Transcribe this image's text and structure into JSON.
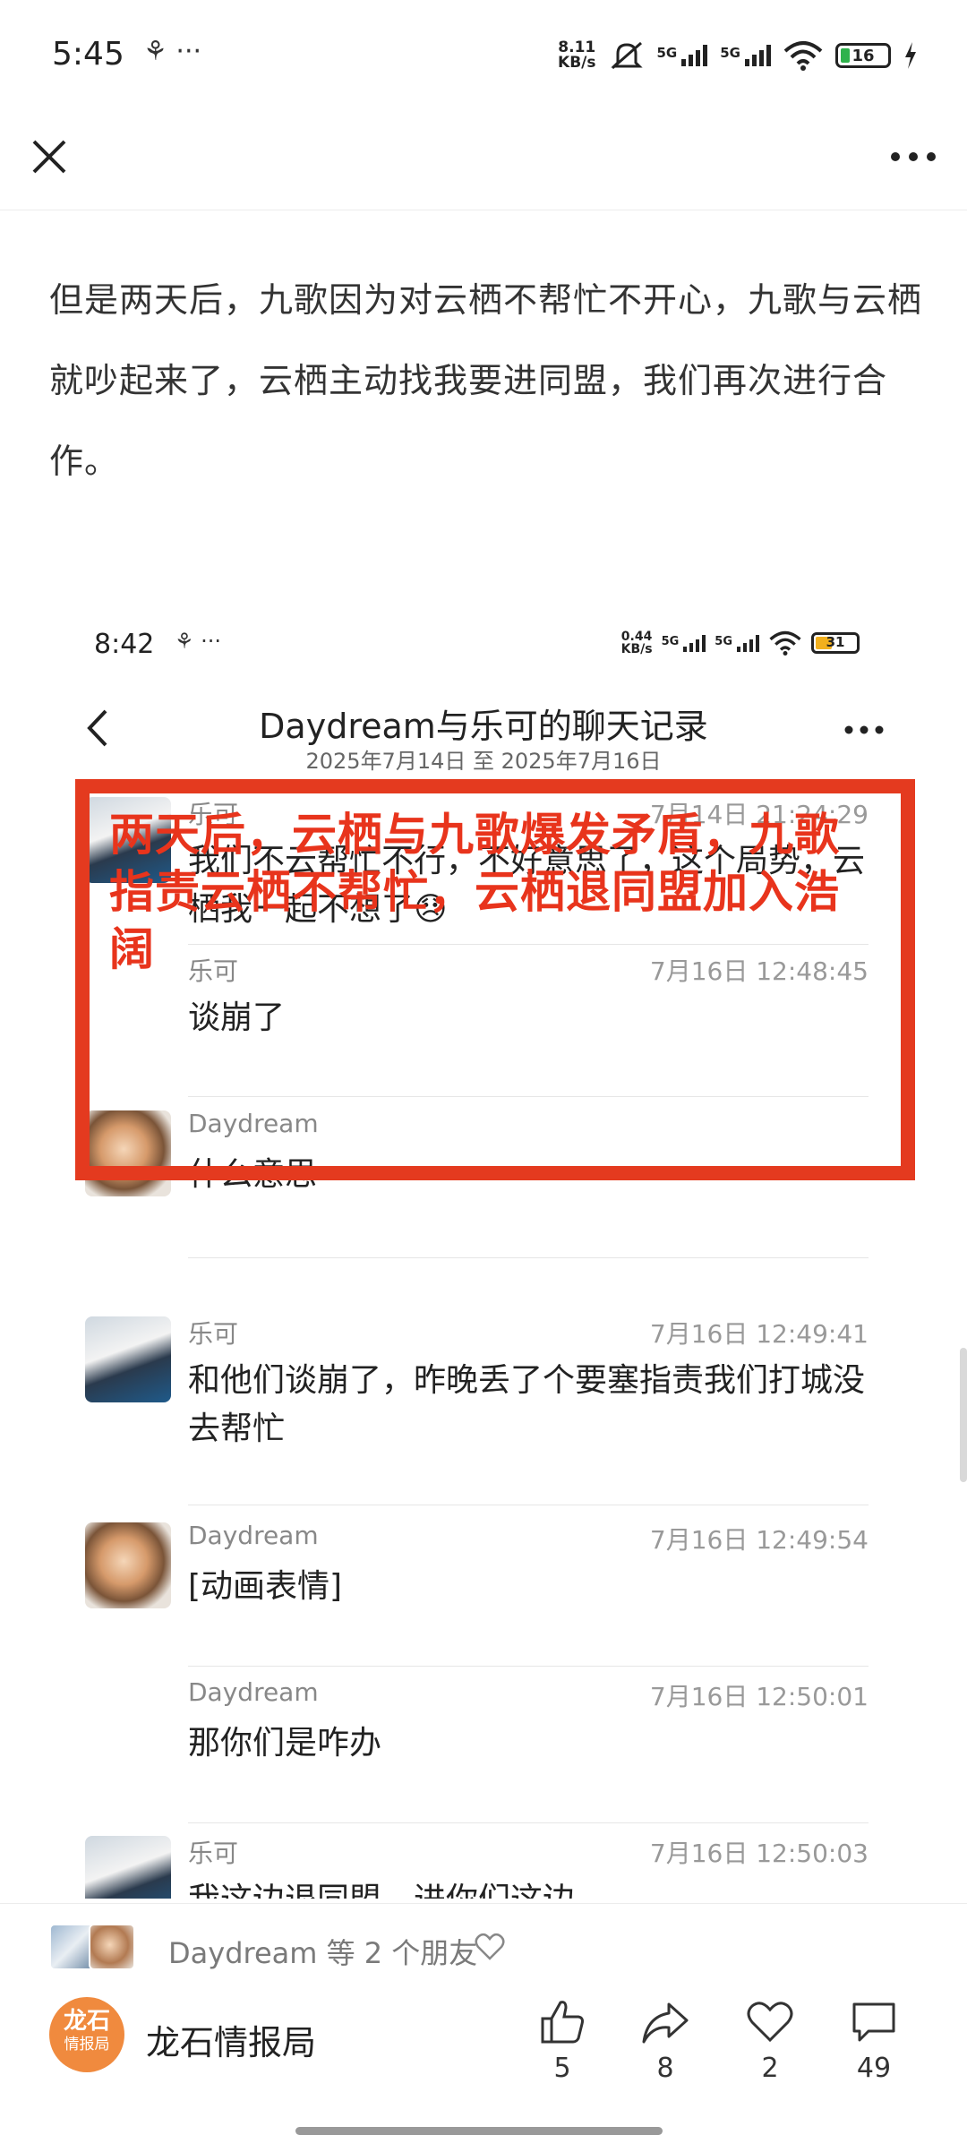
{
  "status_bar": {
    "time": "5:45",
    "left_icons": "⚘ ···",
    "net_speed_value": "8.11",
    "net_speed_unit": "KB/s",
    "signal_1": "5G",
    "signal_2": "5G",
    "battery": "16"
  },
  "article": {
    "paragraph": "但是两天后，九歌因为对云栖不帮忙不开心，九歌与云栖就吵起来了，云栖主动找我要进同盟，我们再次进行合作。"
  },
  "embedded": {
    "status": {
      "time": "8:42",
      "left_icons": "⚘ ···",
      "net_speed_value": "0.44",
      "net_speed_unit": "KB/s",
      "signal_1": "5G",
      "signal_2": "5G",
      "battery": "31"
    },
    "title": "Daydream与乐可的聊天记录",
    "subtitle": "2025年7月14日 至 2025年7月16日",
    "messages": [
      {
        "name": "乐可",
        "time": "7月14日 21:24:29",
        "text": "我们不云帮忙不行，不好意思了，这个局势，云栖我一起不想了😞"
      },
      {
        "name": "乐可",
        "time": "7月16日 12:48:45",
        "text": "谈崩了"
      },
      {
        "name": "Daydream",
        "time": "",
        "text": "什么意思"
      },
      {
        "name": "乐可",
        "time": "7月16日 12:49:41",
        "text": "和他们谈崩了，昨晚丢了个要塞指责我们打城没去帮忙"
      },
      {
        "name": "Daydream",
        "time": "7月16日 12:49:54",
        "text": "[动画表情]"
      },
      {
        "name": "Daydream",
        "time": "7月16日 12:50:01",
        "text": "那你们是咋办"
      },
      {
        "name": "乐可",
        "time": "7月16日 12:50:03",
        "text": "我这边退同盟，进你们这边"
      }
    ],
    "overlay_annotation": "两天后，云栖与九歌爆发矛盾，九歌指责云栖不帮忙，云栖退同盟加入浩阔"
  },
  "friends_bar": {
    "text": "Daydream 等 2 个朋友"
  },
  "bottom_bar": {
    "logo_line1": "龙石",
    "logo_line2": "情报局",
    "author": "龙石情报局",
    "like_count": "5",
    "share_count": "8",
    "favorite_count": "2",
    "comment_count": "49"
  },
  "colors": {
    "annotation_red": "#e43a1f",
    "logo_orange": "#f08a3e"
  }
}
